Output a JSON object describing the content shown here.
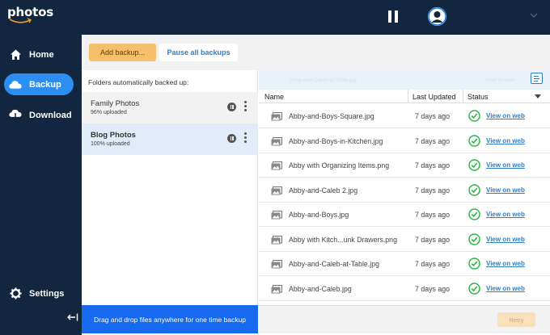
{
  "app": {
    "logo_text": "photos"
  },
  "topbar": {
    "user_name": "",
    "status_icon": "pause-icon"
  },
  "sidebar": {
    "items": [
      {
        "label": "Home",
        "icon": "home-icon"
      },
      {
        "label": "Backup",
        "icon": "cloud-icon",
        "active": true
      },
      {
        "label": "Download",
        "icon": "cloud-download-icon"
      },
      {
        "label": "Settings",
        "icon": "gear-icon"
      }
    ],
    "collapse_icon": "collapse-left-icon"
  },
  "toolbar": {
    "add_backup": "Add backup...",
    "pause_all": "Pause all backups"
  },
  "folders": {
    "title": "Folders automatically backed up:",
    "items": [
      {
        "name": "Family Photos",
        "status": "96% uploaded"
      },
      {
        "name": "Blog Photos",
        "status": "100% uploaded"
      }
    ],
    "drop_hint": "Drag and drop files anywhere for one time backup"
  },
  "files": {
    "columns": {
      "name": "Name",
      "updated": "Last Updated",
      "status": "Status"
    },
    "faint_header": "Abby-and-Caleb-at-Table.jpg",
    "faint_status": "View on web",
    "rows": [
      {
        "name": "Abby-and-Boys-Square.jpg",
        "updated": "7 days ago",
        "link": "View on web"
      },
      {
        "name": "Abby-and-Boys-in-Kitchen.jpg",
        "updated": "7 days ago",
        "link": "View on web"
      },
      {
        "name": "Abby with Organizing Items.png",
        "updated": "7 days ago",
        "link": "View on web"
      },
      {
        "name": "Abby-and-Caleb 2.jpg",
        "updated": "7 days ago",
        "link": "View on web"
      },
      {
        "name": "Abby-and-Boys.jpg",
        "updated": "7 days ago",
        "link": "View on web"
      },
      {
        "name": "Abby with Kitch...unk Drawers.png",
        "updated": "7 days ago",
        "link": "View on web"
      },
      {
        "name": "Abby-and-Caleb-at-Table.jpg",
        "updated": "7 days ago",
        "link": "View on web"
      },
      {
        "name": "Abby-and-Caleb.jpg",
        "updated": "7 days ago",
        "link": "View on web"
      }
    ],
    "retry": "Retry"
  },
  "colors": {
    "sidebar_bg": "#13263f",
    "accent": "#2b8ff1",
    "add_button": "#f6bf6c",
    "drop_bar": "#1769f0",
    "success": "#2fb34a",
    "link": "#2f7ec8"
  }
}
